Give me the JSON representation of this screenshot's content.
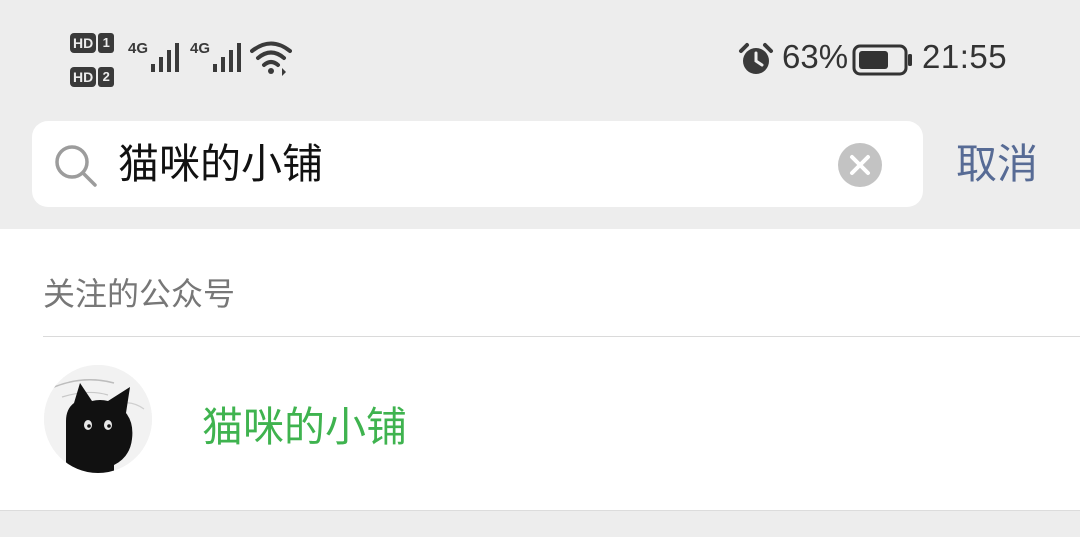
{
  "status_bar": {
    "hd_label": "HD",
    "sim1": "1",
    "sim2": "2",
    "network1": "4G",
    "network2": "4G",
    "battery_percent": "63%",
    "time": "21:55",
    "icons": [
      "hd-sim1-icon",
      "hd-sim2-icon",
      "signal-icon",
      "wifi-icon",
      "alarm-icon",
      "battery-icon"
    ]
  },
  "search": {
    "query": "猫咪的小铺",
    "cancel_label": "取消",
    "icons": [
      "search-icon",
      "clear-icon"
    ]
  },
  "results": {
    "section_title": "关注的公众号",
    "items": [
      {
        "name": "猫咪的小铺",
        "icon": "cat-avatar-icon"
      }
    ]
  },
  "colors": {
    "background": "#ededed",
    "link_blue": "#576b95",
    "highlight_green": "#3fb34f",
    "secondary_text": "#777777"
  }
}
